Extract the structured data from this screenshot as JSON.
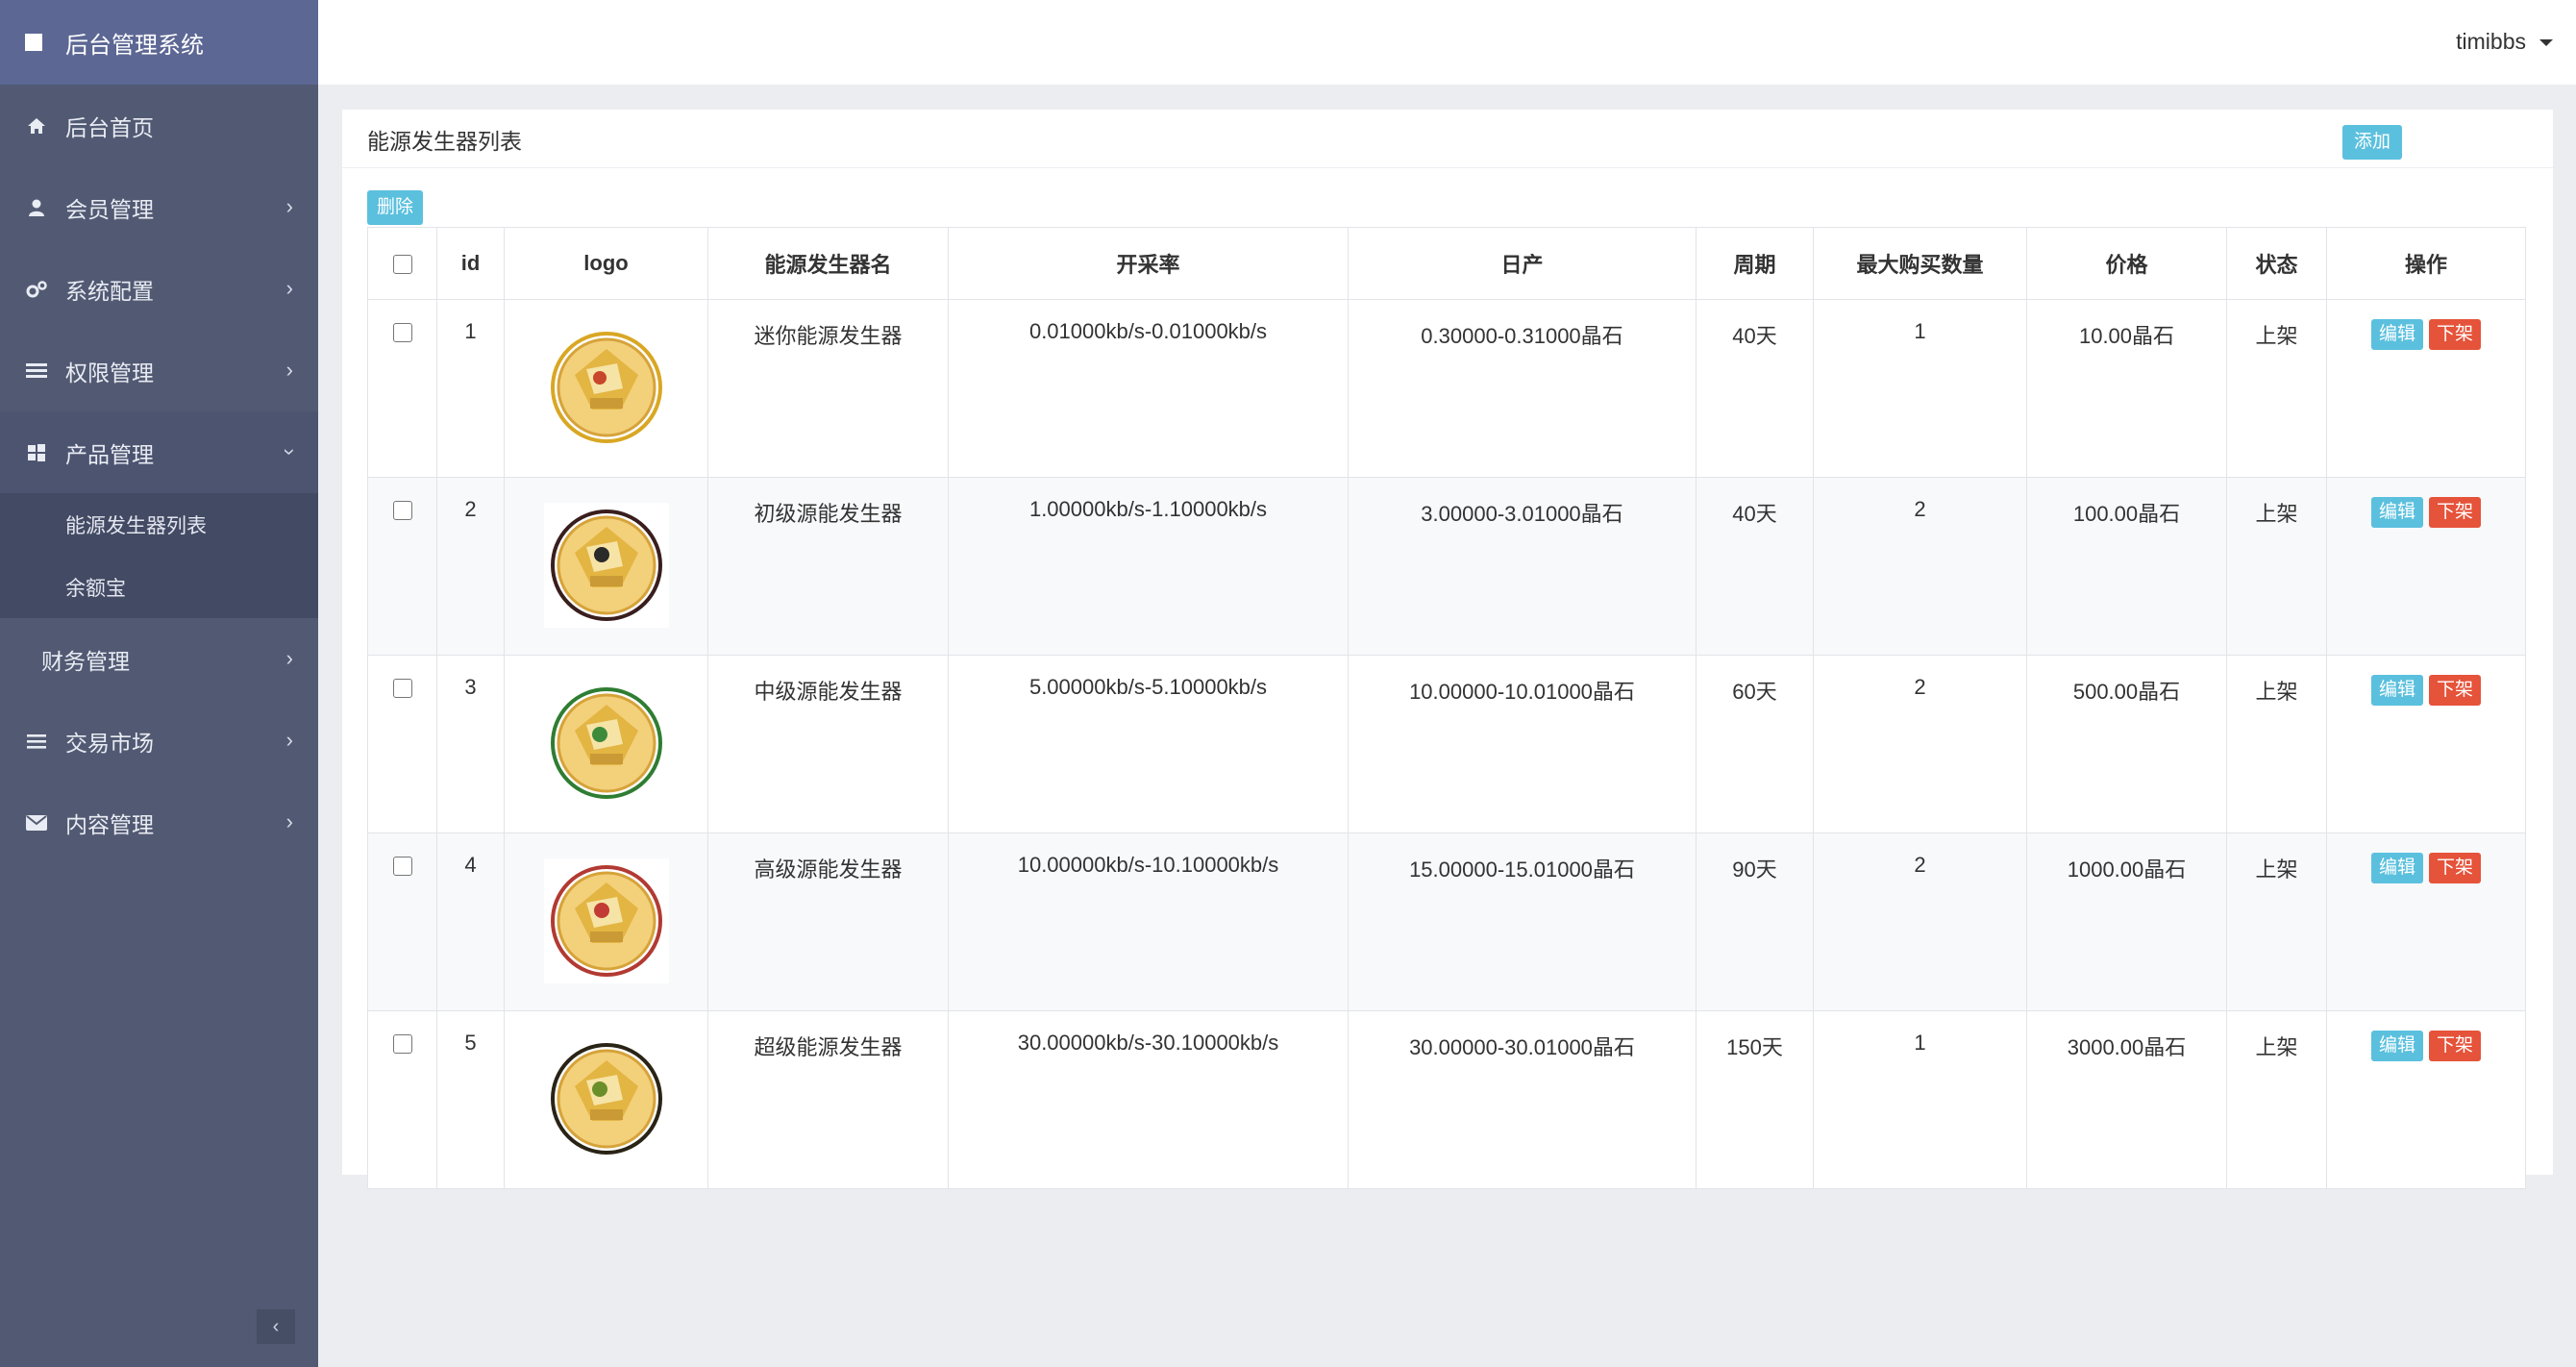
{
  "app": {
    "title": "后台管理系统"
  },
  "sidebar": {
    "items": [
      {
        "label": "后台首页",
        "icon": "home-icon",
        "has_arrow": false
      },
      {
        "label": "会员管理",
        "icon": "user-icon",
        "has_arrow": true
      },
      {
        "label": "系统配置",
        "icon": "gears-icon",
        "has_arrow": true
      },
      {
        "label": "权限管理",
        "icon": "list-icon",
        "has_arrow": true
      },
      {
        "label": "产品管理",
        "icon": "windows-icon",
        "has_arrow": true,
        "open": true,
        "children": [
          {
            "label": "能源发生器列表"
          },
          {
            "label": "余额宝"
          }
        ]
      },
      {
        "label": "财务管理",
        "icon": "",
        "has_arrow": true
      },
      {
        "label": "交易市场",
        "icon": "bars-icon",
        "has_arrow": true
      },
      {
        "label": "内容管理",
        "icon": "envelope-icon",
        "has_arrow": true
      }
    ]
  },
  "header": {
    "username": "timibbs"
  },
  "panel": {
    "title": "能源发生器列表",
    "add_label": "添加",
    "delete_label": "删除"
  },
  "table": {
    "columns": [
      "",
      "id",
      "logo",
      "能源发生器名",
      "开采率",
      "日产",
      "周期",
      "最大购买数量",
      "价格",
      "状态",
      "操作"
    ],
    "edit_label": "编辑",
    "off_label": "下架",
    "rows": [
      {
        "id": "1",
        "name": "迷你能源发生器",
        "rate": "0.01000kb/s-0.01000kb/s",
        "daily": "0.30000-0.31000晶石",
        "period": "40天",
        "max_buy": "1",
        "price": "10.00晶石",
        "status": "上架",
        "ring_color": "#d9a723"
      },
      {
        "id": "2",
        "name": "初级源能发生器",
        "rate": "1.00000kb/s-1.10000kb/s",
        "daily": "3.00000-3.01000晶石",
        "period": "40天",
        "max_buy": "2",
        "price": "100.00晶石",
        "status": "上架",
        "ring_color": "#3a1e1e"
      },
      {
        "id": "3",
        "name": "中级源能发生器",
        "rate": "5.00000kb/s-5.10000kb/s",
        "daily": "10.00000-10.01000晶石",
        "period": "60天",
        "max_buy": "2",
        "price": "500.00晶石",
        "status": "上架",
        "ring_color": "#2f7d32"
      },
      {
        "id": "4",
        "name": "高级源能发生器",
        "rate": "10.00000kb/s-10.10000kb/s",
        "daily": "15.00000-15.01000晶石",
        "period": "90天",
        "max_buy": "2",
        "price": "1000.00晶石",
        "status": "上架",
        "ring_color": "#b23a32"
      },
      {
        "id": "5",
        "name": "超级能源发生器",
        "rate": "30.00000kb/s-30.10000kb/s",
        "daily": "30.00000-30.01000晶石",
        "period": "150天",
        "max_buy": "1",
        "price": "3000.00晶石",
        "status": "上架",
        "ring_color": "#2a2416"
      }
    ]
  }
}
